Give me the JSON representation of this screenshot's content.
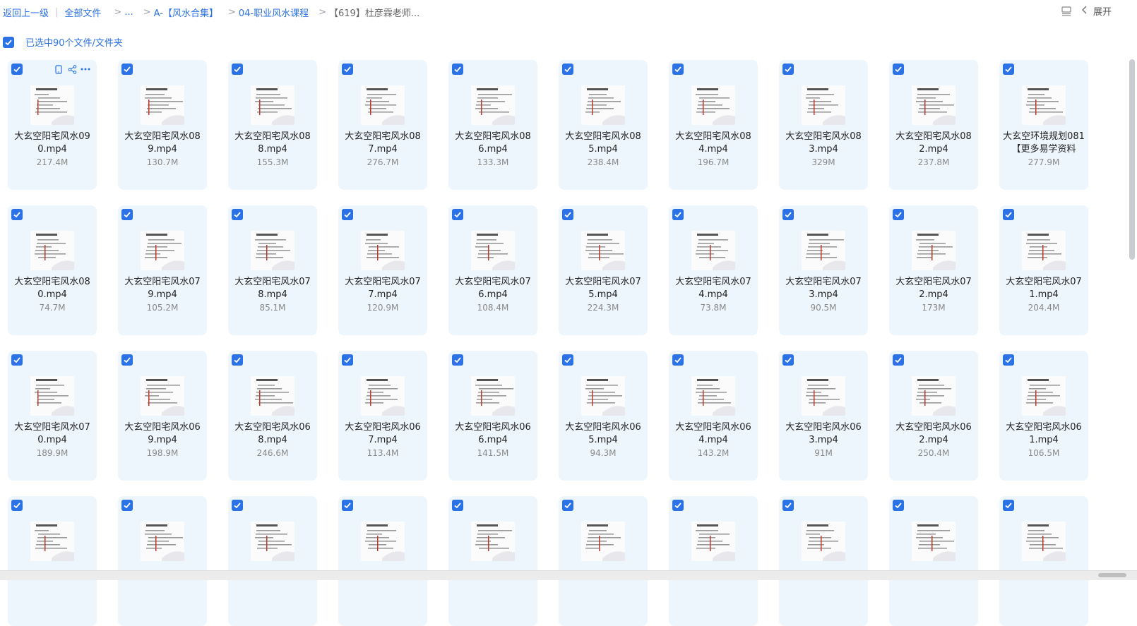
{
  "breadcrumb": {
    "back": "返回上一级",
    "all_files": "全部文件",
    "ellipsis": "...",
    "level1": "A-【风水合集】",
    "level2": "04-职业风水课程",
    "current": "【619】杜彦霖老师..."
  },
  "toolbar": {
    "expand_label": "展开",
    "list_icon": "list-view-icon",
    "chevron_icon": "chevron-left-icon"
  },
  "selection": {
    "text": "已选中90个文件/文件夹"
  },
  "colors": {
    "accent": "#2b72e6",
    "card_bg": "#eef6fd"
  },
  "files": [
    {
      "name": "大玄空阳宅风水090.mp4",
      "size": "217.4M"
    },
    {
      "name": "大玄空阳宅风水089.mp4",
      "size": "130.7M"
    },
    {
      "name": "大玄空阳宅风水088.mp4",
      "size": "155.3M"
    },
    {
      "name": "大玄空阳宅风水087.mp4",
      "size": "276.7M"
    },
    {
      "name": "大玄空阳宅风水086.mp4",
      "size": "133.3M"
    },
    {
      "name": "大玄空阳宅风水085.mp4",
      "size": "238.4M"
    },
    {
      "name": "大玄空阳宅风水084.mp4",
      "size": "196.7M"
    },
    {
      "name": "大玄空阳宅风水083.mp4",
      "size": "329M"
    },
    {
      "name": "大玄空阳宅风水082.mp4",
      "size": "237.8M"
    },
    {
      "name": "大玄空环境规划081【更多易学资料",
      "size": "277.9M"
    },
    {
      "name": "大玄空阳宅风水080.mp4",
      "size": "74.7M"
    },
    {
      "name": "大玄空阳宅风水079.mp4",
      "size": "105.2M"
    },
    {
      "name": "大玄空阳宅风水078.mp4",
      "size": "85.1M"
    },
    {
      "name": "大玄空阳宅风水077.mp4",
      "size": "120.9M"
    },
    {
      "name": "大玄空阳宅风水076.mp4",
      "size": "108.4M"
    },
    {
      "name": "大玄空阳宅风水075.mp4",
      "size": "224.3M"
    },
    {
      "name": "大玄空阳宅风水074.mp4",
      "size": "73.8M"
    },
    {
      "name": "大玄空阳宅风水073.mp4",
      "size": "90.5M"
    },
    {
      "name": "大玄空阳宅风水072.mp4",
      "size": "173M"
    },
    {
      "name": "大玄空阳宅风水071.mp4",
      "size": "204.4M"
    },
    {
      "name": "大玄空阳宅风水070.mp4",
      "size": "189.9M"
    },
    {
      "name": "大玄空阳宅风水069.mp4",
      "size": "198.9M"
    },
    {
      "name": "大玄空阳宅风水068.mp4",
      "size": "246.6M"
    },
    {
      "name": "大玄空阳宅风水067.mp4",
      "size": "113.4M"
    },
    {
      "name": "大玄空阳宅风水066.mp4",
      "size": "141.5M"
    },
    {
      "name": "大玄空阳宅风水065.mp4",
      "size": "94.3M"
    },
    {
      "name": "大玄空阳宅风水064.mp4",
      "size": "143.2M"
    },
    {
      "name": "大玄空阳宅风水063.mp4",
      "size": "91M"
    },
    {
      "name": "大玄空阳宅风水062.mp4",
      "size": "250.4M"
    },
    {
      "name": "大玄空阳宅风水061.mp4",
      "size": "106.5M"
    },
    {
      "name": "",
      "size": ""
    },
    {
      "name": "",
      "size": ""
    },
    {
      "name": "",
      "size": ""
    },
    {
      "name": "",
      "size": ""
    },
    {
      "name": "",
      "size": ""
    },
    {
      "name": "",
      "size": ""
    },
    {
      "name": "",
      "size": ""
    },
    {
      "name": "",
      "size": ""
    },
    {
      "name": "",
      "size": ""
    },
    {
      "name": "",
      "size": ""
    }
  ],
  "card_tools": [
    "phone-icon",
    "share-icon",
    "more-icon"
  ],
  "thumbnail_icon": "video-thumbnail-icon",
  "checkbox_icon": "checkbox-checked-icon"
}
